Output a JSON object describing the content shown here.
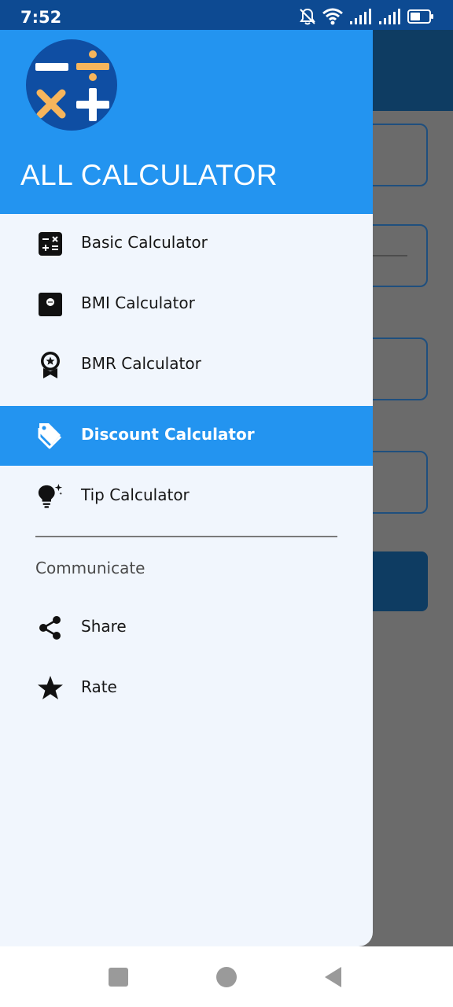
{
  "status_bar": {
    "time": "7:52",
    "icons": [
      "notifications-off-icon",
      "wifi-icon",
      "signal-icon",
      "signal-icon",
      "battery-icon"
    ]
  },
  "drawer": {
    "title": "ALL CALCULATOR",
    "logo_icon": "calculator-operators-logo",
    "items": [
      {
        "label": "Basic Calculator",
        "icon": "calculator-icon",
        "selected": false
      },
      {
        "label": "BMI Calculator",
        "icon": "bmi-icon",
        "selected": false
      },
      {
        "label": "BMR Calculator",
        "icon": "award-icon",
        "selected": false
      },
      {
        "label": "Discount Calculator",
        "icon": "tag-icon",
        "selected": true
      },
      {
        "label": "Tip Calculator",
        "icon": "lightbulb-icon",
        "selected": false
      }
    ],
    "communicate": {
      "title": "Communicate",
      "items": [
        {
          "label": "Share",
          "icon": "share-icon"
        },
        {
          "label": "Rate",
          "icon": "star-icon"
        }
      ]
    }
  },
  "colors": {
    "header": "#2394f0",
    "selected_item": "#2394f0",
    "drawer_background": "#f1f6fd",
    "status_bar": "#0d4a92",
    "logo_background": "#0f4ea3",
    "logo_white": "#ffffff",
    "logo_orange": "#f6b55c"
  },
  "navigation_bar": {
    "buttons": [
      "recent-apps-button",
      "home-button",
      "back-button"
    ]
  }
}
